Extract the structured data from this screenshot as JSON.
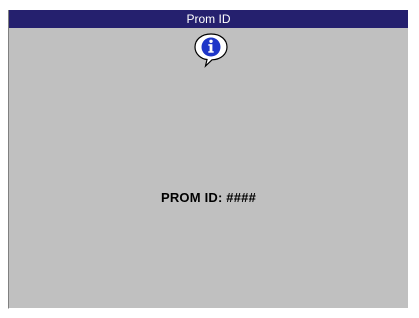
{
  "dialog": {
    "title": "Prom ID",
    "icon": "info-icon",
    "message": "PROM ID: ####"
  },
  "colors": {
    "titlebar": "#25206e",
    "body": "#c0c0c0",
    "icon_blue": "#1e36c8"
  }
}
